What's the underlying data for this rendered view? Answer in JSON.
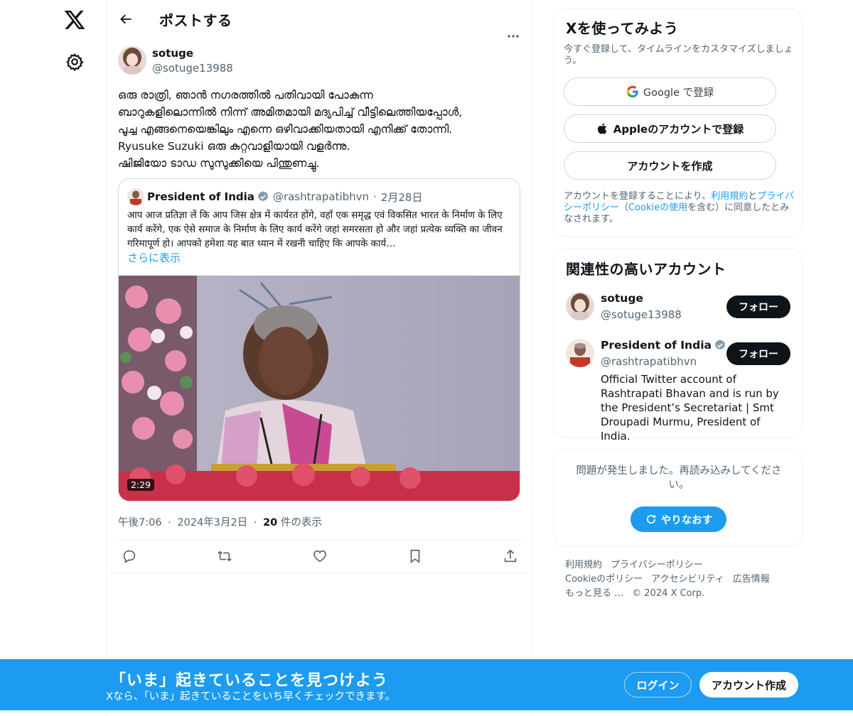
{
  "nav": {
    "logo_icon": "x-logo-icon",
    "settings_icon": "gear-icon"
  },
  "header": {
    "title": "ポストする",
    "back_icon": "arrow-left-icon"
  },
  "post": {
    "author": {
      "name": "sotuge",
      "handle": "@sotuge13988"
    },
    "body_lines": [
      "ഒരു രാത്രി, ഞാൻ നഗരത്തിൽ പതിവായി പോകുന്ന",
      "ബാറുകളിലൊന്നിൽ നിന്ന് അമിതമായി മദ്യപിച്ച് വീട്ടിലെത്തിയപ്പോൾ,",
      "പൂച്ച എങ്ങനെയെങ്കിലും എന്നെ ഒഴിവാക്കിയതായി എനിക്ക് തോന്നി.",
      "Ryusuke Suzuki ഒരു കുറ്റവാളിയായി വളർന്നു.",
      "ഷിജിയോ ടാഡ സുസുക്കിയെ പിന്തുണച്ചു."
    ],
    "quote": {
      "name": "President of India",
      "handle": "@rashtrapatibhvn",
      "separator": "·",
      "date": "2月28日",
      "text": "आप आज प्रतिज्ञा लें कि आप जिस क्षेत्र में कार्यरत होंगे, वहाँ एक समृद्ध एवं विकसित भारत के निर्माण के लिए कार्य करेंगे, एक ऐसे समाज के निर्माण के लिए कार्य करेंगे जहां समरसता हो और जहां प्रत्येक व्यक्ति का जीवन गरिमापूर्ण हो। आपको हमेशा यह बात ध्यान में रखनी चाहिए कि आपके कार्य…",
      "show_more": "さらに表示",
      "video_duration": "2:29"
    },
    "meta": {
      "time": "午後7:06",
      "date": "2024年3月2日",
      "dot": "·",
      "views_count": "20",
      "views_label": " 件の表示"
    },
    "actions": [
      "reply-icon",
      "retweet-icon",
      "like-icon",
      "bookmark-icon",
      "share-icon"
    ]
  },
  "signup_card": {
    "title": "Xを使ってみよう",
    "subtitle": "今すぐ登録して、タイムラインをカスタマイズしましょう。",
    "google_label": "Google で登録",
    "apple_label": "Appleのアカウントで登録",
    "create_label": "アカウントを作成",
    "legal": {
      "p1": "アカウントを登録することにより、",
      "terms": "利用規約",
      "p2": "と",
      "privacy": "プライバシーポリシー",
      "p3": "（",
      "cookie": "Cookieの使用",
      "p4": "を含む）に同意したとみなされます。"
    }
  },
  "related": {
    "title": "関連性の高いアカウント",
    "accounts": [
      {
        "name": "sotuge",
        "handle": "@sotuge13988",
        "follow": "フォロー"
      },
      {
        "name": "President of India",
        "handle": "@rashtrapatibhvn",
        "follow": "フォロー",
        "bio": "Official Twitter account of Rashtrapati Bhavan and is run by the President’s Secretariat | Smt Droupadi Murmu, President of India."
      }
    ]
  },
  "error_card": {
    "message": "問題が発生しました。再読み込みしてください。",
    "retry": "やりなおす"
  },
  "footer": {
    "links": [
      "利用規約",
      "プライバシーポリシー",
      "Cookieのポリシー",
      "アクセシビリティ",
      "広告情報",
      "もっと見る …"
    ],
    "copyright": "© 2024 X Corp."
  },
  "banner": {
    "title": "「いま」起きていることを見つけよう",
    "subtitle": "Xなら、「いま」起きていることをいち早くチェックできます。",
    "login": "ログイン",
    "signup": "アカウント作成"
  },
  "colors": {
    "accent": "#1d9bf0",
    "text": "#0f1419",
    "muted": "#536471",
    "border": "#eff3f4"
  }
}
